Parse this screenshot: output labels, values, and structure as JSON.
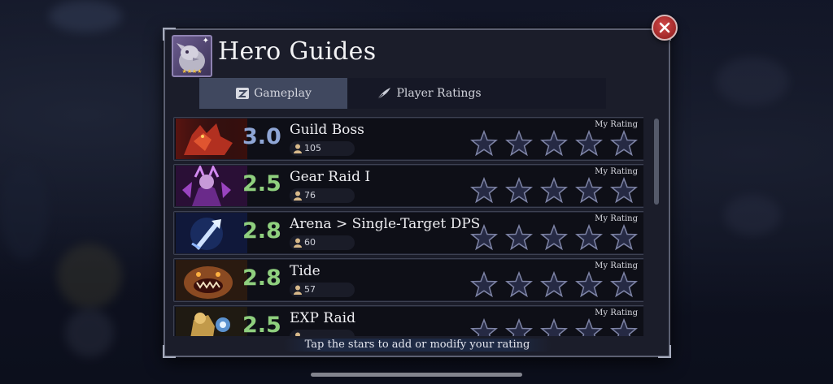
{
  "header": {
    "title": "Hero Guides"
  },
  "tabs": [
    {
      "label": "Gameplay",
      "active": true
    },
    {
      "label": "Player Ratings",
      "active": false
    }
  ],
  "rows": [
    {
      "name": "Guild Boss",
      "score": "3.0",
      "count": "105",
      "my_rating_label": "My Rating",
      "score_color": "#8fa6d6"
    },
    {
      "name": "Gear Raid I",
      "score": "2.5",
      "count": "76",
      "my_rating_label": "My Rating",
      "score_color": "#8fcf7e"
    },
    {
      "name": "Arena > Single-Target DPS",
      "score": "2.8",
      "count": "60",
      "my_rating_label": "My Rating",
      "score_color": "#8fcf7e"
    },
    {
      "name": "Tide",
      "score": "2.8",
      "count": "57",
      "my_rating_label": "My Rating",
      "score_color": "#8fcf7e"
    },
    {
      "name": "EXP Raid",
      "score": "2.5",
      "count": "",
      "my_rating_label": "My Rating",
      "score_color": "#8fcf7e"
    }
  ],
  "footer": {
    "hint": "Tap the stars to add or modify your rating"
  },
  "icons": {
    "close": "close-icon",
    "gameplay": "gameplay-icon",
    "ratings": "feather-quill-icon",
    "user": "user-icon",
    "star": "star-outline-icon"
  }
}
